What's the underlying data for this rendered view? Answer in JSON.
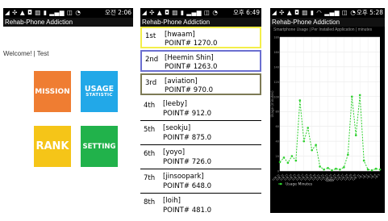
{
  "screens": [
    {
      "status": {
        "icons": "◢ ✣ ▲ ◘ ▥ ▮ ▂▄▆ ◫ ◔",
        "time": "오전 2:06"
      },
      "app_title": "Rehab-Phone Addiction",
      "welcome_text": "Welcome! | Test",
      "tiles": {
        "mission": {
          "label": "MISSION",
          "color": "#ef7d32"
        },
        "usage": {
          "label": "USAGE",
          "sublabel": "STATISTIC",
          "color": "#22a8e8"
        },
        "rank": {
          "label": "RANK",
          "color": "#f5c518"
        },
        "setting": {
          "label": "SETTING",
          "color": "#21b24b"
        }
      }
    },
    {
      "status": {
        "icons": "◢ ✣ ▲ ◘ ▥ ▮ ▂▄▆ ◫ ◔",
        "time": "오후 6:49"
      },
      "app_title": "Rehab-Phone Addiction",
      "rankings": [
        {
          "pos": "1st",
          "name": "[hwaam]",
          "points": "POINT# 1270.0",
          "border_color": "#f3ef4a"
        },
        {
          "pos": "2nd",
          "name": "[Heemin Shin]",
          "points": "POINT# 1263.0",
          "border_color": "#6b6fd0"
        },
        {
          "pos": "3rd",
          "name": "[aviation]",
          "points": "POINT# 970.0",
          "border_color": "#7d7a55"
        },
        {
          "pos": "4th",
          "name": "[leeby]",
          "points": "POINT# 912.0"
        },
        {
          "pos": "5th",
          "name": "[seokju]",
          "points": "POINT# 875.0"
        },
        {
          "pos": "6th",
          "name": "[yoyo]",
          "points": "POINT# 726.0"
        },
        {
          "pos": "7th",
          "name": "[jinsoopark]",
          "points": "POINT# 648.0"
        },
        {
          "pos": "8th",
          "name": "[loih]",
          "points": "POINT# 481.0"
        }
      ]
    },
    {
      "status": {
        "icons": "◢ ✣ ▲ ◘ ▥ ▮ ◠ ▂▄▆ ◫ ◔",
        "time": "오후 5:28"
      },
      "app_title": "Rehab-Phone Addiction",
      "chart_data": {
        "type": "line",
        "title": "Smartphone Usage | Per Installed Application | minutes",
        "xlabel": "Date",
        "ylabel": "Usage (minutes)",
        "x": [
          "12월 11",
          "12월 12",
          "12월 13",
          "12월 14",
          "12월 15",
          "12월 16",
          "12월 17",
          "12월 18",
          "12월 19",
          "12월 20",
          "12월 21",
          "12월 22",
          "12월 23",
          "12월 24",
          "12월 25",
          "12월 26",
          "12월 27",
          "12월 28",
          "12월 29",
          "12월 30",
          "12월 31",
          "1월 1",
          "1월 2",
          "1월 3",
          "1월 4",
          "1월 5"
        ],
        "series": [
          {
            "name": "Usage Minutes",
            "color": "#2fd02f",
            "values": [
              12,
              18,
              11,
              20,
              14,
              95,
              40,
              58,
              28,
              35,
              6,
              2,
              4,
              1,
              3,
              2,
              5,
              22,
              100,
              48,
              102,
              14,
              2,
              1,
              3,
              2
            ]
          }
        ],
        "ylim": [
          0,
          180
        ],
        "yticks": [
          0,
          20,
          40,
          60,
          80,
          100,
          120,
          140,
          160,
          180
        ],
        "grid": true,
        "legend": "bottom-left",
        "plot_bg": "#ffffff",
        "page_bg": "#000000"
      }
    }
  ]
}
